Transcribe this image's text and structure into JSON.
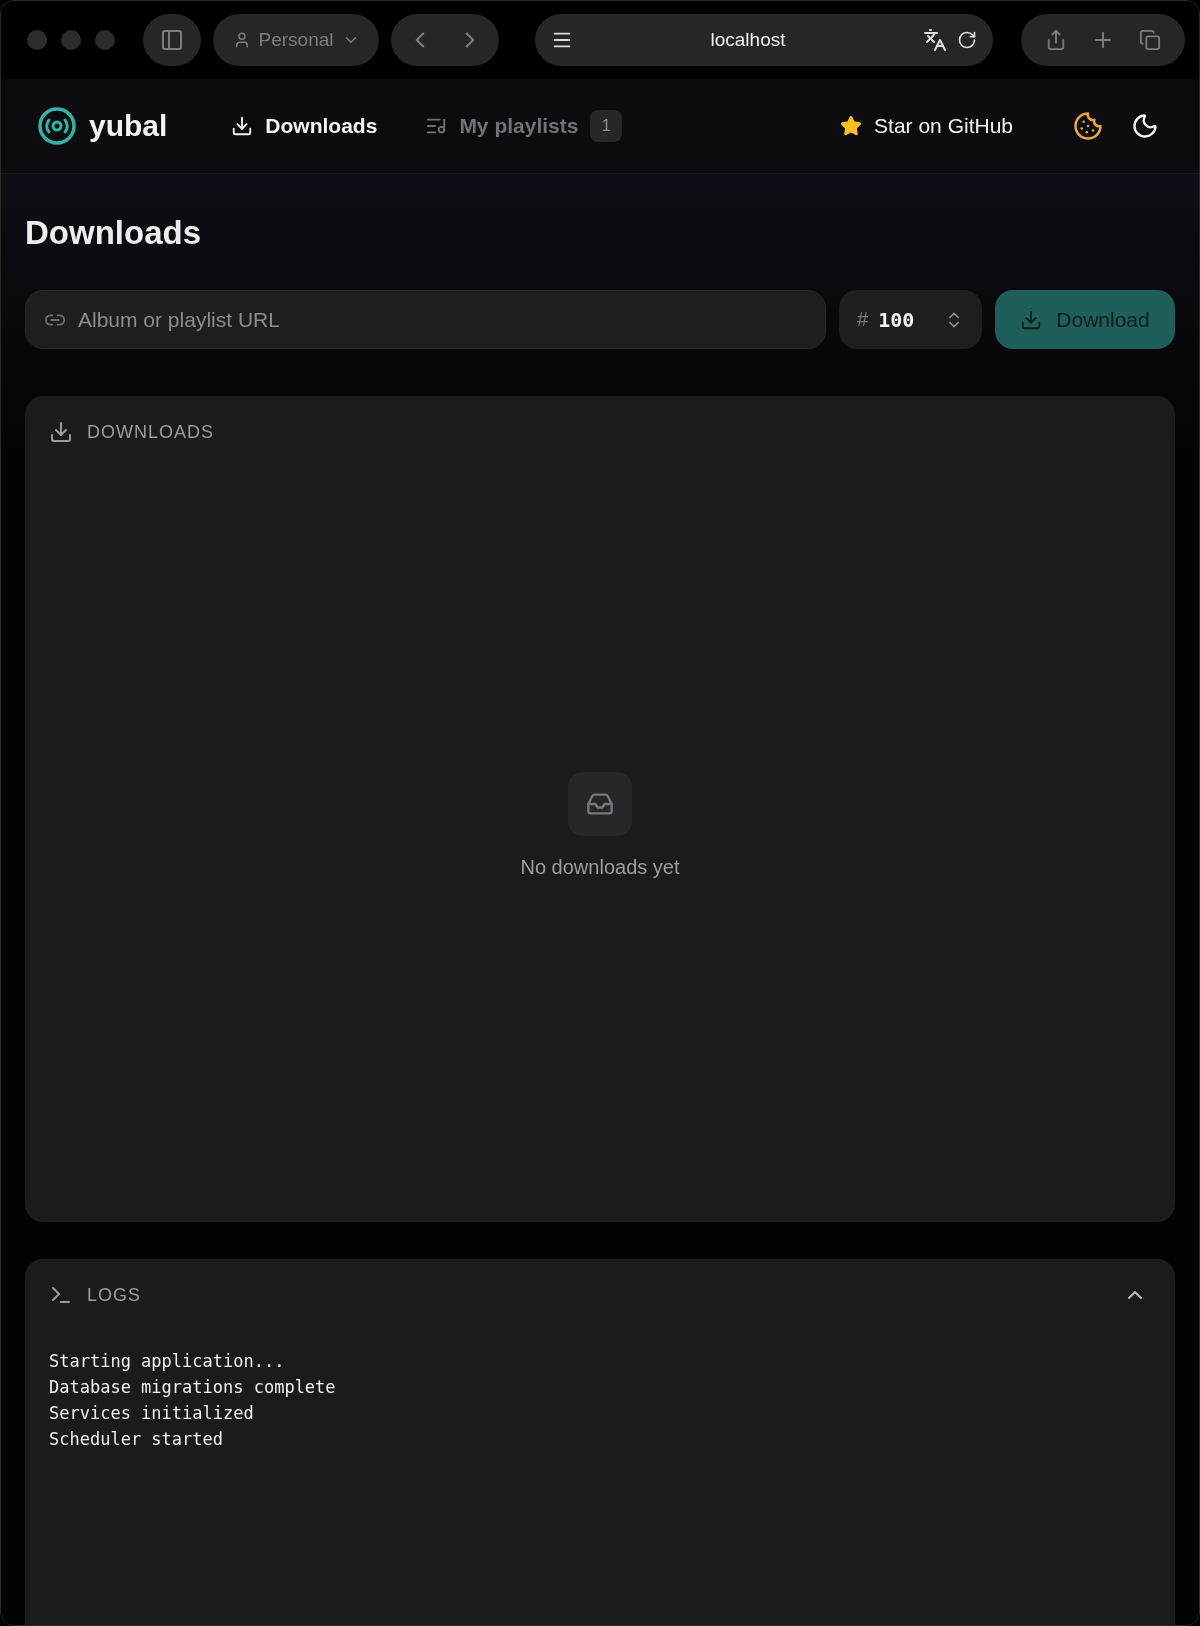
{
  "browser": {
    "profile": "Personal",
    "address": "localhost"
  },
  "nav": {
    "brand": "yubal",
    "links": [
      {
        "label": "Downloads",
        "selected": true
      },
      {
        "label": "My playlists",
        "selected": false,
        "badge": "1"
      }
    ],
    "github": "Star on GitHub"
  },
  "page_title": "Downloads",
  "url_field": {
    "placeholder": "Album or playlist URL"
  },
  "count_field": {
    "prefix": "#",
    "value": "100"
  },
  "download_button": {
    "label": "Download"
  },
  "downloads_panel": {
    "title": "DOWNLOADS",
    "empty_text": "No downloads yet"
  },
  "logs_panel": {
    "title": "LOGS",
    "expanded": true,
    "lines": [
      "Starting application...",
      "Database migrations complete",
      "Services initialized",
      "Scheduler started"
    ]
  }
}
